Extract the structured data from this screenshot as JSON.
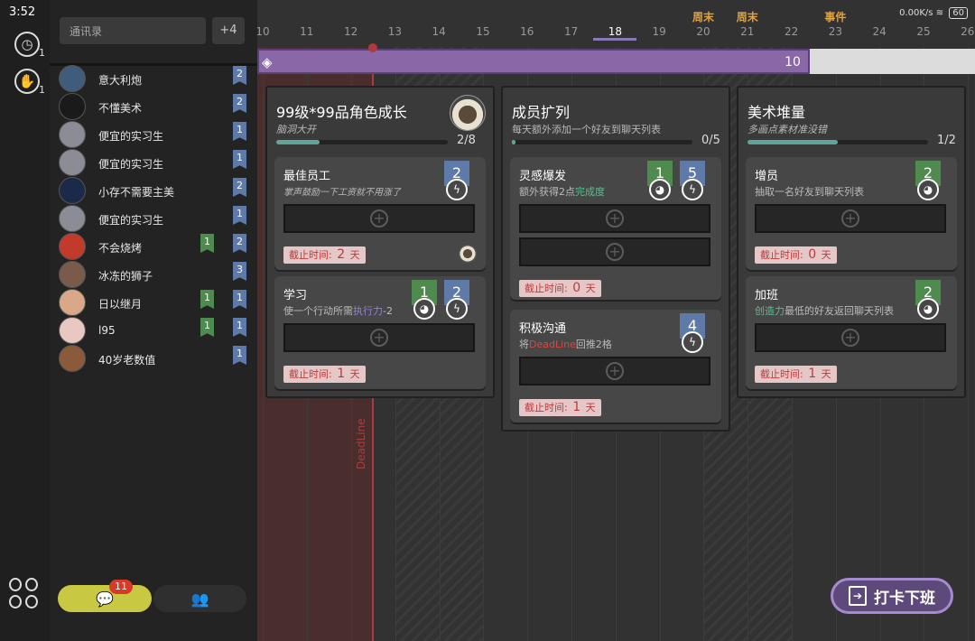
{
  "status_bar": {
    "time": "3:52",
    "network": "0.00K/s",
    "wifi_icon": "wifi-icon",
    "battery": "60"
  },
  "rail": {
    "clock_badge": "1",
    "handshake_badge": "1"
  },
  "contacts": {
    "search_placeholder": "通讯录",
    "extra": "+4",
    "items": [
      {
        "name": "意大利炮",
        "blue": "2",
        "avatar_color": "#3f5c7a"
      },
      {
        "name": "不懂美术",
        "blue": "2",
        "avatar_color": "#1a1a1a"
      },
      {
        "name": "便宜的实习生",
        "blue": "1",
        "avatar_color": "#8c8c96"
      },
      {
        "name": "便宜的实习生",
        "blue": "1",
        "avatar_color": "#8c8c96"
      },
      {
        "name": "小存不需要主美",
        "blue": "2",
        "avatar_color": "#1c2a4a"
      },
      {
        "name": "便宜的实习生",
        "blue": "1",
        "avatar_color": "#8c8c96"
      },
      {
        "name": "不会烧烤",
        "blue": "2",
        "green": "1",
        "avatar_color": "#c23a2a"
      },
      {
        "name": "冰冻的狮子",
        "blue": "3",
        "avatar_color": "#7a5a4a"
      },
      {
        "name": "日以继月",
        "blue": "1",
        "green": "1",
        "avatar_color": "#d8a888"
      },
      {
        "name": "l95",
        "blue": "1",
        "green": "1",
        "avatar_color": "#e8c8c0"
      },
      {
        "name": "40岁老数值",
        "blue": "1",
        "avatar_color": "#8a5a3a"
      }
    ]
  },
  "tabs": {
    "chat_badge": "11",
    "chat_icon": "chat-bubble-icon",
    "group_icon": "group-icon"
  },
  "timeline": {
    "days": [
      "10",
      "11",
      "12",
      "13",
      "14",
      "15",
      "16",
      "17",
      "18",
      "19",
      "20",
      "21",
      "22",
      "23",
      "24",
      "25",
      "26"
    ],
    "current_day": "18",
    "notes": [
      {
        "day": "20",
        "text": "周末"
      },
      {
        "day": "21",
        "text": "周末"
      },
      {
        "day": "23",
        "text": "事件"
      }
    ],
    "weekend_days": [
      "13",
      "14",
      "20",
      "21"
    ],
    "deadline_label": "DeadLine",
    "progress_value": "10",
    "progress_fraction": 0.77
  },
  "panels": [
    {
      "title": "99级*99品角色成长",
      "subtitle": "脑洞大开",
      "progress": "2/8",
      "progress_fraction": 0.25,
      "tasks": [
        {
          "title": "最佳员工",
          "desc": "掌声鼓励一下工资就不用涨了",
          "reqs": [
            {
              "color": "blue",
              "value": "2",
              "icon": "lightning-icon"
            }
          ],
          "deadline_label": "截止时间:",
          "deadline_value": "2",
          "deadline_unit": "天"
        },
        {
          "title": "学习",
          "desc_pre": "使一个行动所需",
          "desc_hl": "执行力",
          "desc_post": "-2",
          "reqs": [
            {
              "color": "green",
              "value": "1",
              "icon": "palette-icon"
            },
            {
              "color": "blue",
              "value": "2",
              "icon": "lightning-icon"
            }
          ],
          "deadline_label": "截止时间:",
          "deadline_value": "1",
          "deadline_unit": "天"
        }
      ]
    },
    {
      "title": "成员扩列",
      "subtitle": "每天额外添加一个好友到聊天列表",
      "progress": "0/5",
      "progress_fraction": 0.02,
      "tasks": [
        {
          "title": "灵感爆发",
          "desc_pre": "额外获得2点",
          "desc_hl": "完成度",
          "desc_post": "",
          "reqs": [
            {
              "color": "green",
              "value": "1",
              "icon": "palette-icon"
            },
            {
              "color": "blue",
              "value": "5",
              "icon": "lightning-icon"
            }
          ],
          "deadline_label": "截止时间:",
          "deadline_value": "0",
          "deadline_unit": "天"
        },
        {
          "title": "积极沟通",
          "desc_pre": "将",
          "desc_hl": "DeadLine",
          "desc_post": "回推2格",
          "reqs": [
            {
              "color": "blue",
              "value": "4",
              "icon": "lightning-icon"
            }
          ],
          "deadline_label": "截止时间:",
          "deadline_value": "1",
          "deadline_unit": "天"
        }
      ]
    },
    {
      "title": "美术堆量",
      "subtitle": "多画点素材准没错",
      "progress": "1/2",
      "progress_fraction": 0.5,
      "tasks": [
        {
          "title": "增员",
          "desc": "抽取一名好友到聊天列表",
          "reqs": [
            {
              "color": "green",
              "value": "2",
              "icon": "palette-icon"
            }
          ],
          "deadline_label": "截止时间:",
          "deadline_value": "0",
          "deadline_unit": "天"
        },
        {
          "title": "加班",
          "desc_hl": "创造力",
          "desc_post": "最低的好友返回聊天列表",
          "reqs": [
            {
              "color": "green",
              "value": "2",
              "icon": "palette-icon"
            }
          ],
          "deadline_label": "截止时间:",
          "deadline_value": "1",
          "deadline_unit": "天"
        }
      ]
    }
  ],
  "action_button": {
    "label": "打卡下班",
    "icon": "exit-door-icon"
  }
}
